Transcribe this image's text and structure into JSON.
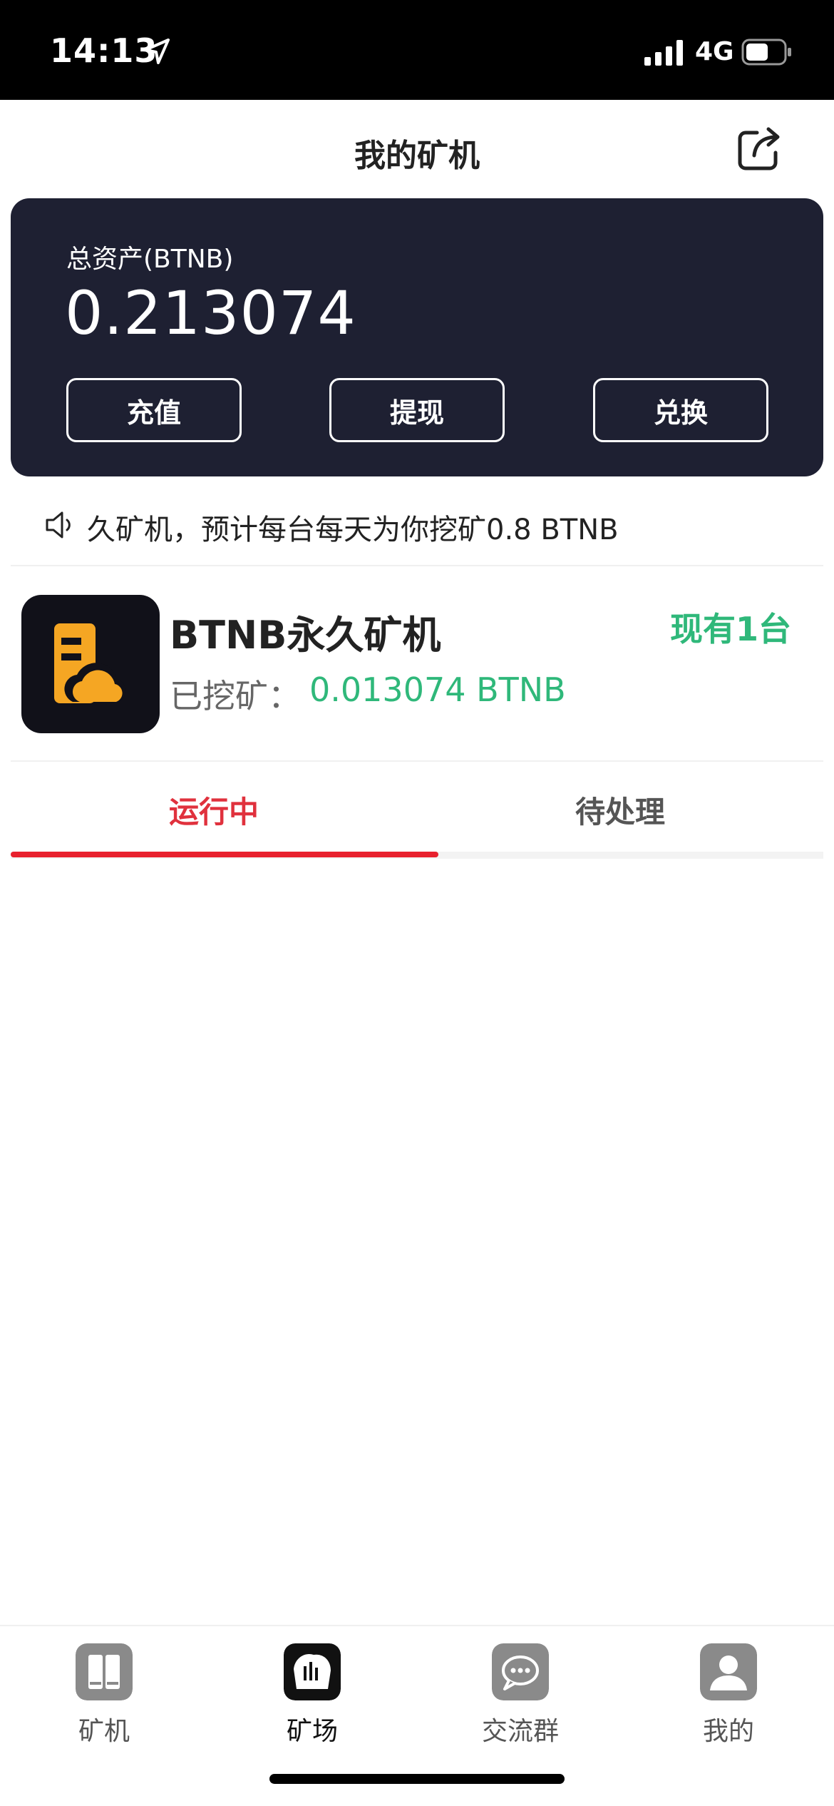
{
  "status_bar": {
    "time": "14:13",
    "network": "4G"
  },
  "header": {
    "title": "我的矿机"
  },
  "assets": {
    "label": "总资产(BTNB)",
    "value": "0.213074",
    "buttons": [
      "充值",
      "提现",
      "兑换"
    ]
  },
  "notice": {
    "text": "久矿机，预计每台每天为你挖矿0.8 BTNB"
  },
  "machine": {
    "name": "BTNB永久矿机",
    "count_label": "现有1台",
    "mined_label": "已挖矿：",
    "mined_value": "0.013074 BTNB"
  },
  "tabs": [
    {
      "label": "运行中",
      "active": true
    },
    {
      "label": "待处理",
      "active": false
    }
  ],
  "tabbar": [
    {
      "label": "矿机",
      "icon": "mining-machine-icon"
    },
    {
      "label": "矿场",
      "icon": "mine-field-icon",
      "active": true
    },
    {
      "label": "交流群",
      "icon": "chat-group-icon"
    },
    {
      "label": "我的",
      "icon": "profile-icon"
    }
  ],
  "colors": {
    "accent_green": "#2fb87a",
    "accent_red": "#e8212e",
    "card_bg": "#1e2032",
    "machine_icon": "#f5a623"
  }
}
